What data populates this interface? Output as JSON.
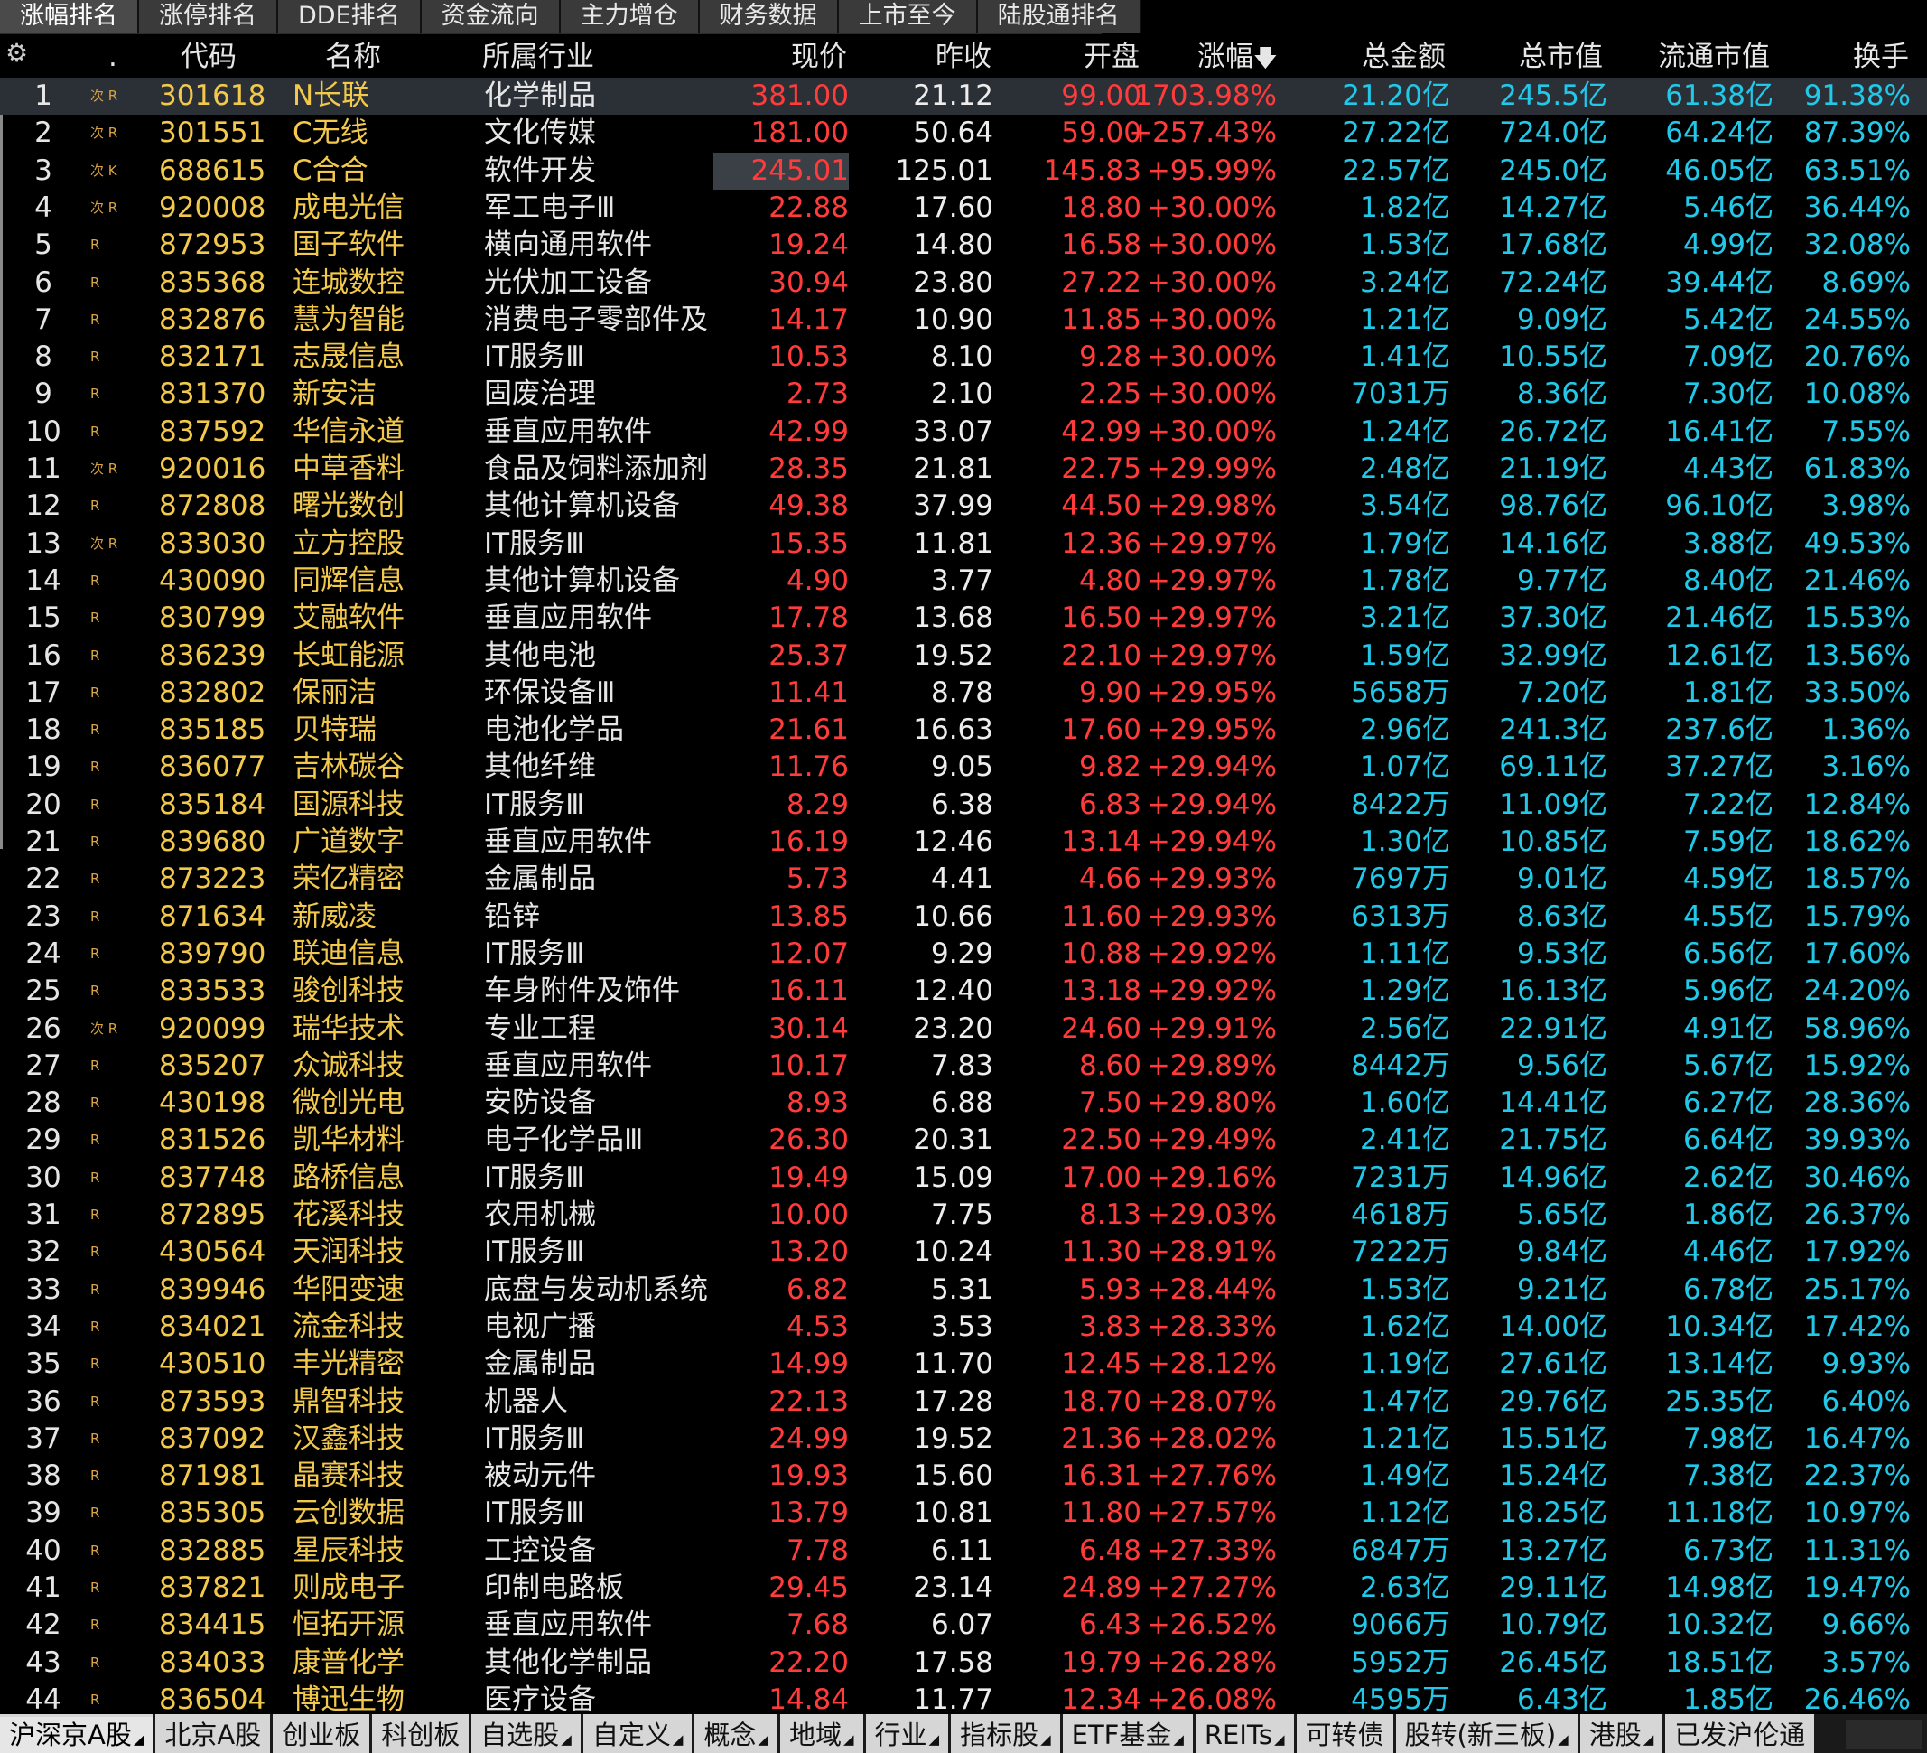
{
  "top_tabs": [
    "涨幅排名",
    "涨停排名",
    "DDE排名",
    "资金流向",
    "主力增仓",
    "财务数据",
    "上市至今",
    "陆股通排名"
  ],
  "header": {
    "dot": ".",
    "code": "代码",
    "name": "名称",
    "industry": "所属行业",
    "price": "现价",
    "prev_close": "昨收",
    "open": "开盘",
    "change_pct": "涨幅",
    "sort_icon": "arrow-down-icon",
    "amount": "总金额",
    "market_cap": "总市值",
    "float_cap": "流通市值",
    "turnover": "换手"
  },
  "rows": [
    {
      "idx": "1",
      "flag": "次 R",
      "code": "301618",
      "name": "N长联",
      "industry": "化学制品",
      "price": "381.00",
      "prev": "21.12",
      "open": "99.00",
      "pct": "1703.98%",
      "amount": "21.20亿",
      "mcap": "245.5亿",
      "fcap": "61.38亿",
      "turn": "91.38%"
    },
    {
      "idx": "2",
      "flag": "次 R",
      "code": "301551",
      "name": "C无线",
      "industry": "文化传媒",
      "price": "181.00",
      "prev": "50.64",
      "open": "59.00",
      "pct": "+257.43%",
      "amount": "27.22亿",
      "mcap": "724.0亿",
      "fcap": "64.24亿",
      "turn": "87.39%"
    },
    {
      "idx": "3",
      "flag": "次 K",
      "code": "688615",
      "name": "C合合",
      "industry": "软件开发",
      "price": "245.01",
      "prev": "125.01",
      "open": "145.83",
      "pct": "+95.99%",
      "amount": "22.57亿",
      "mcap": "245.0亿",
      "fcap": "46.05亿",
      "turn": "63.51%"
    },
    {
      "idx": "4",
      "flag": "次 R",
      "code": "920008",
      "name": "成电光信",
      "industry": "军工电子Ⅲ",
      "price": "22.88",
      "prev": "17.60",
      "open": "18.80",
      "pct": "+30.00%",
      "amount": "1.82亿",
      "mcap": "14.27亿",
      "fcap": "5.46亿",
      "turn": "36.44%"
    },
    {
      "idx": "5",
      "flag": "R",
      "code": "872953",
      "name": "国子软件",
      "industry": "横向通用软件",
      "price": "19.24",
      "prev": "14.80",
      "open": "16.58",
      "pct": "+30.00%",
      "amount": "1.53亿",
      "mcap": "17.68亿",
      "fcap": "4.99亿",
      "turn": "32.08%"
    },
    {
      "idx": "6",
      "flag": "R",
      "code": "835368",
      "name": "连城数控",
      "industry": "光伏加工设备",
      "price": "30.94",
      "prev": "23.80",
      "open": "27.22",
      "pct": "+30.00%",
      "amount": "3.24亿",
      "mcap": "72.24亿",
      "fcap": "39.44亿",
      "turn": "8.69%"
    },
    {
      "idx": "7",
      "flag": "R",
      "code": "832876",
      "name": "慧为智能",
      "industry": "消费电子零部件及",
      "price": "14.17",
      "prev": "10.90",
      "open": "11.85",
      "pct": "+30.00%",
      "amount": "1.21亿",
      "mcap": "9.09亿",
      "fcap": "5.42亿",
      "turn": "24.55%"
    },
    {
      "idx": "8",
      "flag": "R",
      "code": "832171",
      "name": "志晟信息",
      "industry": "IT服务Ⅲ",
      "price": "10.53",
      "prev": "8.10",
      "open": "9.28",
      "pct": "+30.00%",
      "amount": "1.41亿",
      "mcap": "10.55亿",
      "fcap": "7.09亿",
      "turn": "20.76%"
    },
    {
      "idx": "9",
      "flag": "R",
      "code": "831370",
      "name": "新安洁",
      "industry": "固废治理",
      "price": "2.73",
      "prev": "2.10",
      "open": "2.25",
      "pct": "+30.00%",
      "amount": "7031万",
      "mcap": "8.36亿",
      "fcap": "7.30亿",
      "turn": "10.08%"
    },
    {
      "idx": "10",
      "flag": "R",
      "code": "837592",
      "name": "华信永道",
      "industry": "垂直应用软件",
      "price": "42.99",
      "prev": "33.07",
      "open": "42.99",
      "pct": "+30.00%",
      "amount": "1.24亿",
      "mcap": "26.72亿",
      "fcap": "16.41亿",
      "turn": "7.55%"
    },
    {
      "idx": "11",
      "flag": "次 R",
      "code": "920016",
      "name": "中草香料",
      "industry": "食品及饲料添加剂",
      "price": "28.35",
      "prev": "21.81",
      "open": "22.75",
      "pct": "+29.99%",
      "amount": "2.48亿",
      "mcap": "21.19亿",
      "fcap": "4.43亿",
      "turn": "61.83%"
    },
    {
      "idx": "12",
      "flag": "R",
      "code": "872808",
      "name": "曙光数创",
      "industry": "其他计算机设备",
      "price": "49.38",
      "prev": "37.99",
      "open": "44.50",
      "pct": "+29.98%",
      "amount": "3.54亿",
      "mcap": "98.76亿",
      "fcap": "96.10亿",
      "turn": "3.98%"
    },
    {
      "idx": "13",
      "flag": "次 R",
      "code": "833030",
      "name": "立方控股",
      "industry": "IT服务Ⅲ",
      "price": "15.35",
      "prev": "11.81",
      "open": "12.36",
      "pct": "+29.97%",
      "amount": "1.79亿",
      "mcap": "14.16亿",
      "fcap": "3.88亿",
      "turn": "49.53%"
    },
    {
      "idx": "14",
      "flag": "R",
      "code": "430090",
      "name": "同辉信息",
      "industry": "其他计算机设备",
      "price": "4.90",
      "prev": "3.77",
      "open": "4.80",
      "pct": "+29.97%",
      "amount": "1.78亿",
      "mcap": "9.77亿",
      "fcap": "8.40亿",
      "turn": "21.46%"
    },
    {
      "idx": "15",
      "flag": "R",
      "code": "830799",
      "name": "艾融软件",
      "industry": "垂直应用软件",
      "price": "17.78",
      "prev": "13.68",
      "open": "16.50",
      "pct": "+29.97%",
      "amount": "3.21亿",
      "mcap": "37.30亿",
      "fcap": "21.46亿",
      "turn": "15.53%"
    },
    {
      "idx": "16",
      "flag": "R",
      "code": "836239",
      "name": "长虹能源",
      "industry": "其他电池",
      "price": "25.37",
      "prev": "19.52",
      "open": "22.10",
      "pct": "+29.97%",
      "amount": "1.59亿",
      "mcap": "32.99亿",
      "fcap": "12.61亿",
      "turn": "13.56%"
    },
    {
      "idx": "17",
      "flag": "R",
      "code": "832802",
      "name": "保丽洁",
      "industry": "环保设备Ⅲ",
      "price": "11.41",
      "prev": "8.78",
      "open": "9.90",
      "pct": "+29.95%",
      "amount": "5658万",
      "mcap": "7.20亿",
      "fcap": "1.81亿",
      "turn": "33.50%"
    },
    {
      "idx": "18",
      "flag": "R",
      "code": "835185",
      "name": "贝特瑞",
      "industry": "电池化学品",
      "price": "21.61",
      "prev": "16.63",
      "open": "17.60",
      "pct": "+29.95%",
      "amount": "2.96亿",
      "mcap": "241.3亿",
      "fcap": "237.6亿",
      "turn": "1.36%"
    },
    {
      "idx": "19",
      "flag": "R",
      "code": "836077",
      "name": "吉林碳谷",
      "industry": "其他纤维",
      "price": "11.76",
      "prev": "9.05",
      "open": "9.82",
      "pct": "+29.94%",
      "amount": "1.07亿",
      "mcap": "69.11亿",
      "fcap": "37.27亿",
      "turn": "3.16%"
    },
    {
      "idx": "20",
      "flag": "R",
      "code": "835184",
      "name": "国源科技",
      "industry": "IT服务Ⅲ",
      "price": "8.29",
      "prev": "6.38",
      "open": "6.83",
      "pct": "+29.94%",
      "amount": "8422万",
      "mcap": "11.09亿",
      "fcap": "7.22亿",
      "turn": "12.84%"
    },
    {
      "idx": "21",
      "flag": "R",
      "code": "839680",
      "name": "广道数字",
      "industry": "垂直应用软件",
      "price": "16.19",
      "prev": "12.46",
      "open": "13.14",
      "pct": "+29.94%",
      "amount": "1.30亿",
      "mcap": "10.85亿",
      "fcap": "7.59亿",
      "turn": "18.62%"
    },
    {
      "idx": "22",
      "flag": "R",
      "code": "873223",
      "name": "荣亿精密",
      "industry": "金属制品",
      "price": "5.73",
      "prev": "4.41",
      "open": "4.66",
      "pct": "+29.93%",
      "amount": "7697万",
      "mcap": "9.01亿",
      "fcap": "4.59亿",
      "turn": "18.57%"
    },
    {
      "idx": "23",
      "flag": "R",
      "code": "871634",
      "name": "新威凌",
      "industry": "铅锌",
      "price": "13.85",
      "prev": "10.66",
      "open": "11.60",
      "pct": "+29.93%",
      "amount": "6313万",
      "mcap": "8.63亿",
      "fcap": "4.55亿",
      "turn": "15.79%"
    },
    {
      "idx": "24",
      "flag": "R",
      "code": "839790",
      "name": "联迪信息",
      "industry": "IT服务Ⅲ",
      "price": "12.07",
      "prev": "9.29",
      "open": "10.88",
      "pct": "+29.92%",
      "amount": "1.11亿",
      "mcap": "9.53亿",
      "fcap": "6.56亿",
      "turn": "17.60%"
    },
    {
      "idx": "25",
      "flag": "R",
      "code": "833533",
      "name": "骏创科技",
      "industry": "车身附件及饰件",
      "price": "16.11",
      "prev": "12.40",
      "open": "13.18",
      "pct": "+29.92%",
      "amount": "1.29亿",
      "mcap": "16.13亿",
      "fcap": "5.96亿",
      "turn": "24.20%"
    },
    {
      "idx": "26",
      "flag": "次 R",
      "code": "920099",
      "name": "瑞华技术",
      "industry": "专业工程",
      "price": "30.14",
      "prev": "23.20",
      "open": "24.60",
      "pct": "+29.91%",
      "amount": "2.56亿",
      "mcap": "22.91亿",
      "fcap": "4.91亿",
      "turn": "58.96%"
    },
    {
      "idx": "27",
      "flag": "R",
      "code": "835207",
      "name": "众诚科技",
      "industry": "垂直应用软件",
      "price": "10.17",
      "prev": "7.83",
      "open": "8.60",
      "pct": "+29.89%",
      "amount": "8442万",
      "mcap": "9.56亿",
      "fcap": "5.67亿",
      "turn": "15.92%"
    },
    {
      "idx": "28",
      "flag": "R",
      "code": "430198",
      "name": "微创光电",
      "industry": "安防设备",
      "price": "8.93",
      "prev": "6.88",
      "open": "7.50",
      "pct": "+29.80%",
      "amount": "1.60亿",
      "mcap": "14.41亿",
      "fcap": "6.27亿",
      "turn": "28.36%"
    },
    {
      "idx": "29",
      "flag": "R",
      "code": "831526",
      "name": "凯华材料",
      "industry": "电子化学品Ⅲ",
      "price": "26.30",
      "prev": "20.31",
      "open": "22.50",
      "pct": "+29.49%",
      "amount": "2.41亿",
      "mcap": "21.75亿",
      "fcap": "6.64亿",
      "turn": "39.93%"
    },
    {
      "idx": "30",
      "flag": "R",
      "code": "837748",
      "name": "路桥信息",
      "industry": "IT服务Ⅲ",
      "price": "19.49",
      "prev": "15.09",
      "open": "17.00",
      "pct": "+29.16%",
      "amount": "7231万",
      "mcap": "14.96亿",
      "fcap": "2.62亿",
      "turn": "30.46%"
    },
    {
      "idx": "31",
      "flag": "R",
      "code": "872895",
      "name": "花溪科技",
      "industry": "农用机械",
      "price": "10.00",
      "prev": "7.75",
      "open": "8.13",
      "pct": "+29.03%",
      "amount": "4618万",
      "mcap": "5.65亿",
      "fcap": "1.86亿",
      "turn": "26.37%"
    },
    {
      "idx": "32",
      "flag": "R",
      "code": "430564",
      "name": "天润科技",
      "industry": "IT服务Ⅲ",
      "price": "13.20",
      "prev": "10.24",
      "open": "11.30",
      "pct": "+28.91%",
      "amount": "7222万",
      "mcap": "9.84亿",
      "fcap": "4.46亿",
      "turn": "17.92%"
    },
    {
      "idx": "33",
      "flag": "R",
      "code": "839946",
      "name": "华阳变速",
      "industry": "底盘与发动机系统",
      "price": "6.82",
      "prev": "5.31",
      "open": "5.93",
      "pct": "+28.44%",
      "amount": "1.53亿",
      "mcap": "9.21亿",
      "fcap": "6.78亿",
      "turn": "25.17%"
    },
    {
      "idx": "34",
      "flag": "R",
      "code": "834021",
      "name": "流金科技",
      "industry": "电视广播",
      "price": "4.53",
      "prev": "3.53",
      "open": "3.83",
      "pct": "+28.33%",
      "amount": "1.62亿",
      "mcap": "14.00亿",
      "fcap": "10.34亿",
      "turn": "17.42%"
    },
    {
      "idx": "35",
      "flag": "R",
      "code": "430510",
      "name": "丰光精密",
      "industry": "金属制品",
      "price": "14.99",
      "prev": "11.70",
      "open": "12.45",
      "pct": "+28.12%",
      "amount": "1.19亿",
      "mcap": "27.61亿",
      "fcap": "13.14亿",
      "turn": "9.93%"
    },
    {
      "idx": "36",
      "flag": "R",
      "code": "873593",
      "name": "鼎智科技",
      "industry": "机器人",
      "price": "22.13",
      "prev": "17.28",
      "open": "18.70",
      "pct": "+28.07%",
      "amount": "1.47亿",
      "mcap": "29.76亿",
      "fcap": "25.35亿",
      "turn": "6.40%"
    },
    {
      "idx": "37",
      "flag": "R",
      "code": "837092",
      "name": "汉鑫科技",
      "industry": "IT服务Ⅲ",
      "price": "24.99",
      "prev": "19.52",
      "open": "21.36",
      "pct": "+28.02%",
      "amount": "1.21亿",
      "mcap": "15.51亿",
      "fcap": "7.98亿",
      "turn": "16.47%"
    },
    {
      "idx": "38",
      "flag": "R",
      "code": "871981",
      "name": "晶赛科技",
      "industry": "被动元件",
      "price": "19.93",
      "prev": "15.60",
      "open": "16.31",
      "pct": "+27.76%",
      "amount": "1.49亿",
      "mcap": "15.24亿",
      "fcap": "7.38亿",
      "turn": "22.37%"
    },
    {
      "idx": "39",
      "flag": "R",
      "code": "835305",
      "name": "云创数据",
      "industry": "IT服务Ⅲ",
      "price": "13.79",
      "prev": "10.81",
      "open": "11.80",
      "pct": "+27.57%",
      "amount": "1.12亿",
      "mcap": "18.25亿",
      "fcap": "11.18亿",
      "turn": "10.97%"
    },
    {
      "idx": "40",
      "flag": "R",
      "code": "832885",
      "name": "星辰科技",
      "industry": "工控设备",
      "price": "7.78",
      "prev": "6.11",
      "open": "6.48",
      "pct": "+27.33%",
      "amount": "6847万",
      "mcap": "13.27亿",
      "fcap": "6.73亿",
      "turn": "11.31%"
    },
    {
      "idx": "41",
      "flag": "R",
      "code": "837821",
      "name": "则成电子",
      "industry": "印制电路板",
      "price": "29.45",
      "prev": "23.14",
      "open": "24.89",
      "pct": "+27.27%",
      "amount": "2.63亿",
      "mcap": "29.11亿",
      "fcap": "14.98亿",
      "turn": "19.47%"
    },
    {
      "idx": "42",
      "flag": "R",
      "code": "834415",
      "name": "恒拓开源",
      "industry": "垂直应用软件",
      "price": "7.68",
      "prev": "6.07",
      "open": "6.43",
      "pct": "+26.52%",
      "amount": "9066万",
      "mcap": "10.79亿",
      "fcap": "10.32亿",
      "turn": "9.66%"
    },
    {
      "idx": "43",
      "flag": "R",
      "code": "834033",
      "name": "康普化学",
      "industry": "其他化学制品",
      "price": "22.20",
      "prev": "17.58",
      "open": "19.79",
      "pct": "+26.28%",
      "amount": "5952万",
      "mcap": "26.45亿",
      "fcap": "18.51亿",
      "turn": "3.57%"
    },
    {
      "idx": "44",
      "flag": "R",
      "code": "836504",
      "name": "博迅生物",
      "industry": "医疗设备",
      "price": "14.84",
      "prev": "11.77",
      "open": "12.34",
      "pct": "+26.08%",
      "amount": "4595万",
      "mcap": "6.43亿",
      "fcap": "1.85亿",
      "turn": "26.46%"
    }
  ],
  "bottom_tabs": [
    {
      "label": "沪深京A股",
      "caret": "◢"
    },
    {
      "label": "北京A股",
      "caret": ""
    },
    {
      "label": "创业板",
      "caret": ""
    },
    {
      "label": "科创板",
      "caret": ""
    },
    {
      "label": "自选股",
      "caret": "◢"
    },
    {
      "label": "自定义",
      "caret": "◢"
    },
    {
      "label": "概念",
      "caret": "◢"
    },
    {
      "label": "地域",
      "caret": "◢"
    },
    {
      "label": "行业",
      "caret": "◢"
    },
    {
      "label": "指标股",
      "caret": "◢"
    },
    {
      "label": "ETF基金",
      "caret": "◢"
    },
    {
      "label": "REITs",
      "caret": "◢"
    },
    {
      "label": "可转债",
      "caret": ""
    },
    {
      "label": "股转(新三板)",
      "caret": "◢"
    },
    {
      "label": "港股",
      "caret": "◢"
    },
    {
      "label": "已发沪伦通",
      "caret": ""
    }
  ],
  "colors": {
    "up": "#ff3b3b",
    "code": "#f2c94c",
    "cyan": "#22c8e8"
  }
}
